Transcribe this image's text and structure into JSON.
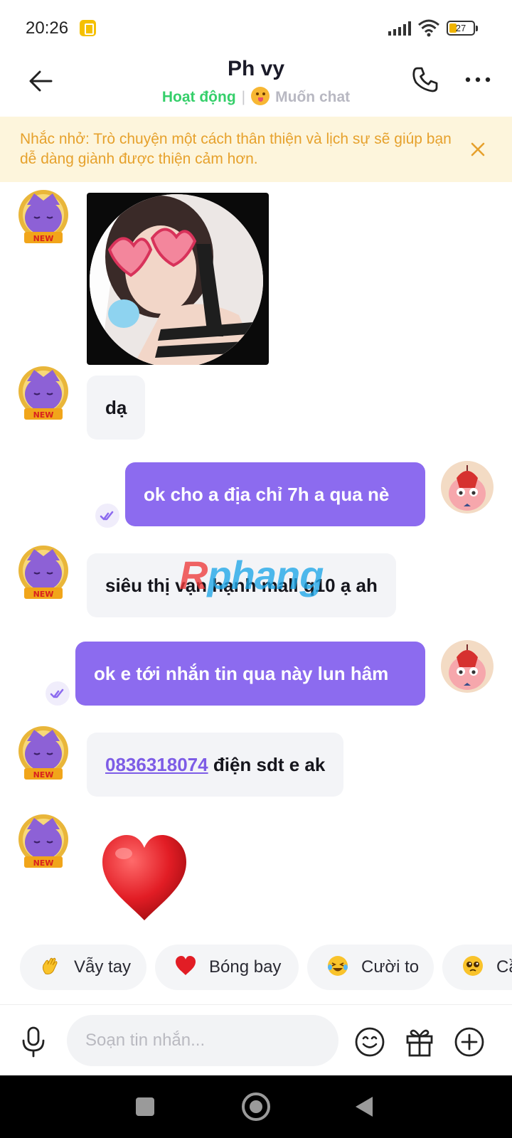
{
  "status_bar": {
    "time": "20:26",
    "battery": "27"
  },
  "header": {
    "title": "Ph vy",
    "status_active": "Hoạt động",
    "status_separator": "|",
    "status_want_chat": "Muốn chat"
  },
  "reminder": {
    "text": "Nhắc nhở: Trò chuyện một cách thân thiện và lịch sự sẽ giúp bạn dễ dàng giành được thiện cảm hơn."
  },
  "messages": {
    "m2_text": "dạ",
    "m3_text": "ok cho a địa chỉ 7h a qua nè",
    "m4_text": "siêu thị vạn hạnh mall q10 ạ ah",
    "m5_text": "ok e tới nhắn tin qua này lun hâm",
    "m6_phone": "0836318074",
    "m6_rest": " điện sdt e ak",
    "new_badge": "NEW"
  },
  "watermark": {
    "first": "R",
    "rest": "phang"
  },
  "quick_reactions": {
    "wave": "Vẫy tay",
    "balloon": "Bóng bay",
    "laugh": "Cười to",
    "fourth": "Cầ"
  },
  "input": {
    "placeholder": "Soạn tin nhắn..."
  },
  "colors": {
    "accent": "#8c6bef",
    "online": "#35cf6a",
    "reminder_bg": "#fdf5dc",
    "reminder_text": "#e6a12c"
  }
}
